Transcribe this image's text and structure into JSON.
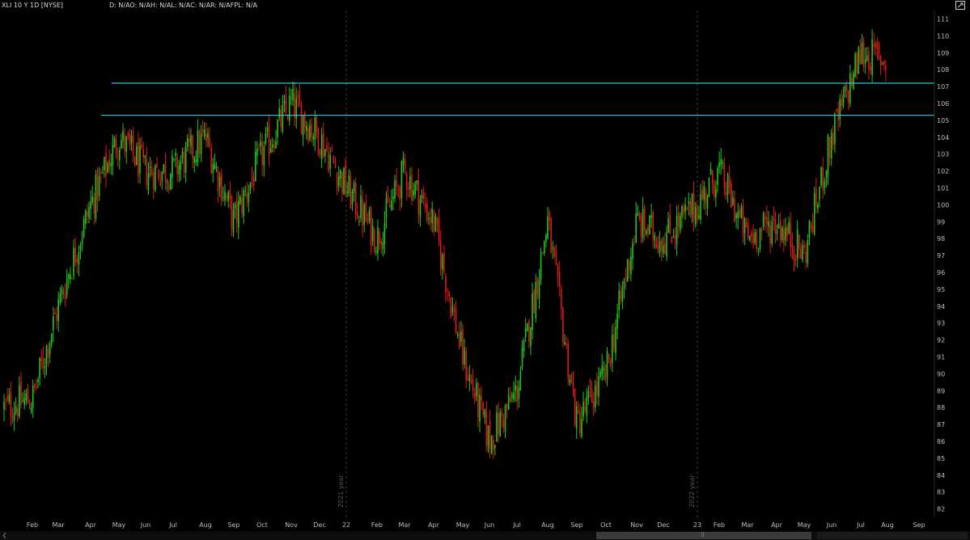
{
  "header": {
    "symbol": "XLI 10 Y 1D [NYSE]",
    "quote": "D: N/AO: N/AH: N/AL: N/AC: N/AR: N/AFPL: N/A",
    "settings_icon": "expand-icon"
  },
  "colors": {
    "background": "#000000",
    "up": "#1ec81e",
    "down": "#e01818",
    "level": "#25c9d8",
    "axis_text": "#bdbdbd",
    "separator": "#3c3c3c"
  },
  "chart_data": {
    "type": "candlestick",
    "y_range": [
      81.5,
      111.5
    ],
    "y_ticks": [
      82,
      83,
      84,
      85,
      86,
      87,
      88,
      89,
      90,
      91,
      92,
      93,
      94,
      95,
      96,
      97,
      98,
      99,
      100,
      101,
      102,
      103,
      104,
      105,
      106,
      107,
      108,
      109,
      110,
      111
    ],
    "y_tick_labels": [
      "82",
      "83",
      "84",
      "85",
      "86",
      "87",
      "88",
      "89",
      "90",
      "91",
      "92",
      "93",
      "94",
      "95",
      "96",
      "97",
      "98",
      "99",
      "100",
      "101",
      "102",
      "103",
      "104",
      "105",
      "106",
      "107",
      "108",
      "109",
      "110",
      "111"
    ],
    "x_labels": [
      "Feb",
      "Mar",
      "Apr",
      "May",
      "Jun",
      "Jul",
      "Aug",
      "Sep",
      "Oct",
      "Nov",
      "Dec",
      "22",
      "Feb",
      "Mar",
      "Apr",
      "May",
      "Jun",
      "Jul",
      "Aug",
      "Sep",
      "Oct",
      "Nov",
      "Dec",
      "23",
      "Feb",
      "Mar",
      "Apr",
      "May",
      "Jun",
      "Jul",
      "Aug",
      "Sep"
    ],
    "year_markers": [
      {
        "text": "2021 year",
        "index": 11
      },
      {
        "text": "2022 year",
        "index": 23
      }
    ],
    "horizontal_levels": [
      {
        "price": 107.2,
        "start_month": "Apr 2021"
      },
      {
        "price": 105.3,
        "start_month": "Apr 2021"
      }
    ],
    "price_path": [
      {
        "month": "Jan 2021",
        "close": 88
      },
      {
        "month": "Feb 2021",
        "close": 88.5
      },
      {
        "month": "Mar 2021",
        "close": 94
      },
      {
        "month": "Apr 2021",
        "close": 100
      },
      {
        "month": "May 2021",
        "close": 104
      },
      {
        "month": "Jun 2021",
        "close": 102
      },
      {
        "month": "Jul 2021",
        "close": 102
      },
      {
        "month": "Aug 2021",
        "close": 104
      },
      {
        "month": "Sep 2021",
        "close": 99
      },
      {
        "month": "Oct 2021",
        "close": 103
      },
      {
        "month": "Nov 2021",
        "close": 106
      },
      {
        "month": "Dec 2021",
        "close": 104
      },
      {
        "month": "Jan 2022",
        "close": 101
      },
      {
        "month": "Feb 2022",
        "close": 98
      },
      {
        "month": "Mar 2022",
        "close": 102
      },
      {
        "month": "Apr 2022",
        "close": 99
      },
      {
        "month": "May 2022",
        "close": 91
      },
      {
        "month": "Jun 2022",
        "close": 86
      },
      {
        "month": "Jul 2022",
        "close": 89
      },
      {
        "month": "Aug 2022",
        "close": 99
      },
      {
        "month": "Sep 2022",
        "close": 87
      },
      {
        "month": "Oct 2022",
        "close": 90
      },
      {
        "month": "Nov 2022",
        "close": 99
      },
      {
        "month": "Dec 2022",
        "close": 98
      },
      {
        "month": "Jan 2023",
        "close": 100
      },
      {
        "month": "Feb 2023",
        "close": 102
      },
      {
        "month": "Mar 2023",
        "close": 98
      },
      {
        "month": "Apr 2023",
        "close": 99
      },
      {
        "month": "May 2023",
        "close": 97
      },
      {
        "month": "Jun 2023",
        "close": 104
      },
      {
        "month": "Jul 2023",
        "close": 109
      },
      {
        "month": "Aug 2023",
        "close": 108.5
      }
    ]
  },
  "scrollbar": {
    "grip": "⠿"
  }
}
